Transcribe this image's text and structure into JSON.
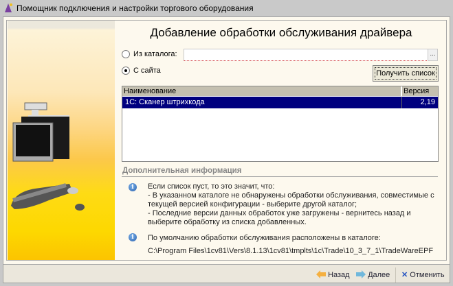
{
  "window": {
    "title": "Помощник подключения и настройки торгового оборудования"
  },
  "page": {
    "heading": "Добавление обработки обслуживания драйвера"
  },
  "source": {
    "catalog_label": "Из каталога:",
    "catalog_value": "",
    "catalog_selected": false,
    "site_label": "С сайта",
    "site_selected": true,
    "browse_label": "...",
    "get_list_label": "Получить список"
  },
  "table": {
    "columns": [
      "Наименование",
      "Версия"
    ],
    "rows": [
      {
        "name": "1С: Сканер штрихкода",
        "version": "2,19",
        "selected": true
      }
    ]
  },
  "info": {
    "header": "Дополнительная информация",
    "block1": [
      "Если список пуст, то это значит, что:",
      "- В указанном каталоге не обнаружены обработки обслуживания, совместимые с",
      "текущей версией конфигурации - выберите другой каталог;",
      "- Последние версии данных обработок уже загружены - вернитесь назад и",
      "выберите обработку из списка добавленных."
    ],
    "block2": [
      "По умолчанию обработки обслуживания расположены в каталоге:",
      "C:\\Program Files\\1cv81\\Vers\\8.1.13\\1cv81\\tmplts\\1c\\Trade\\10_3_7_1\\TradeWareEPF"
    ]
  },
  "buttons": {
    "back": "Назад",
    "next": "Далее",
    "cancel": "Отменить"
  },
  "colors": {
    "selection": "#00007f",
    "accent_back": "#f0a020",
    "accent_next": "#60b0d8",
    "cancel": "#2050c0"
  }
}
